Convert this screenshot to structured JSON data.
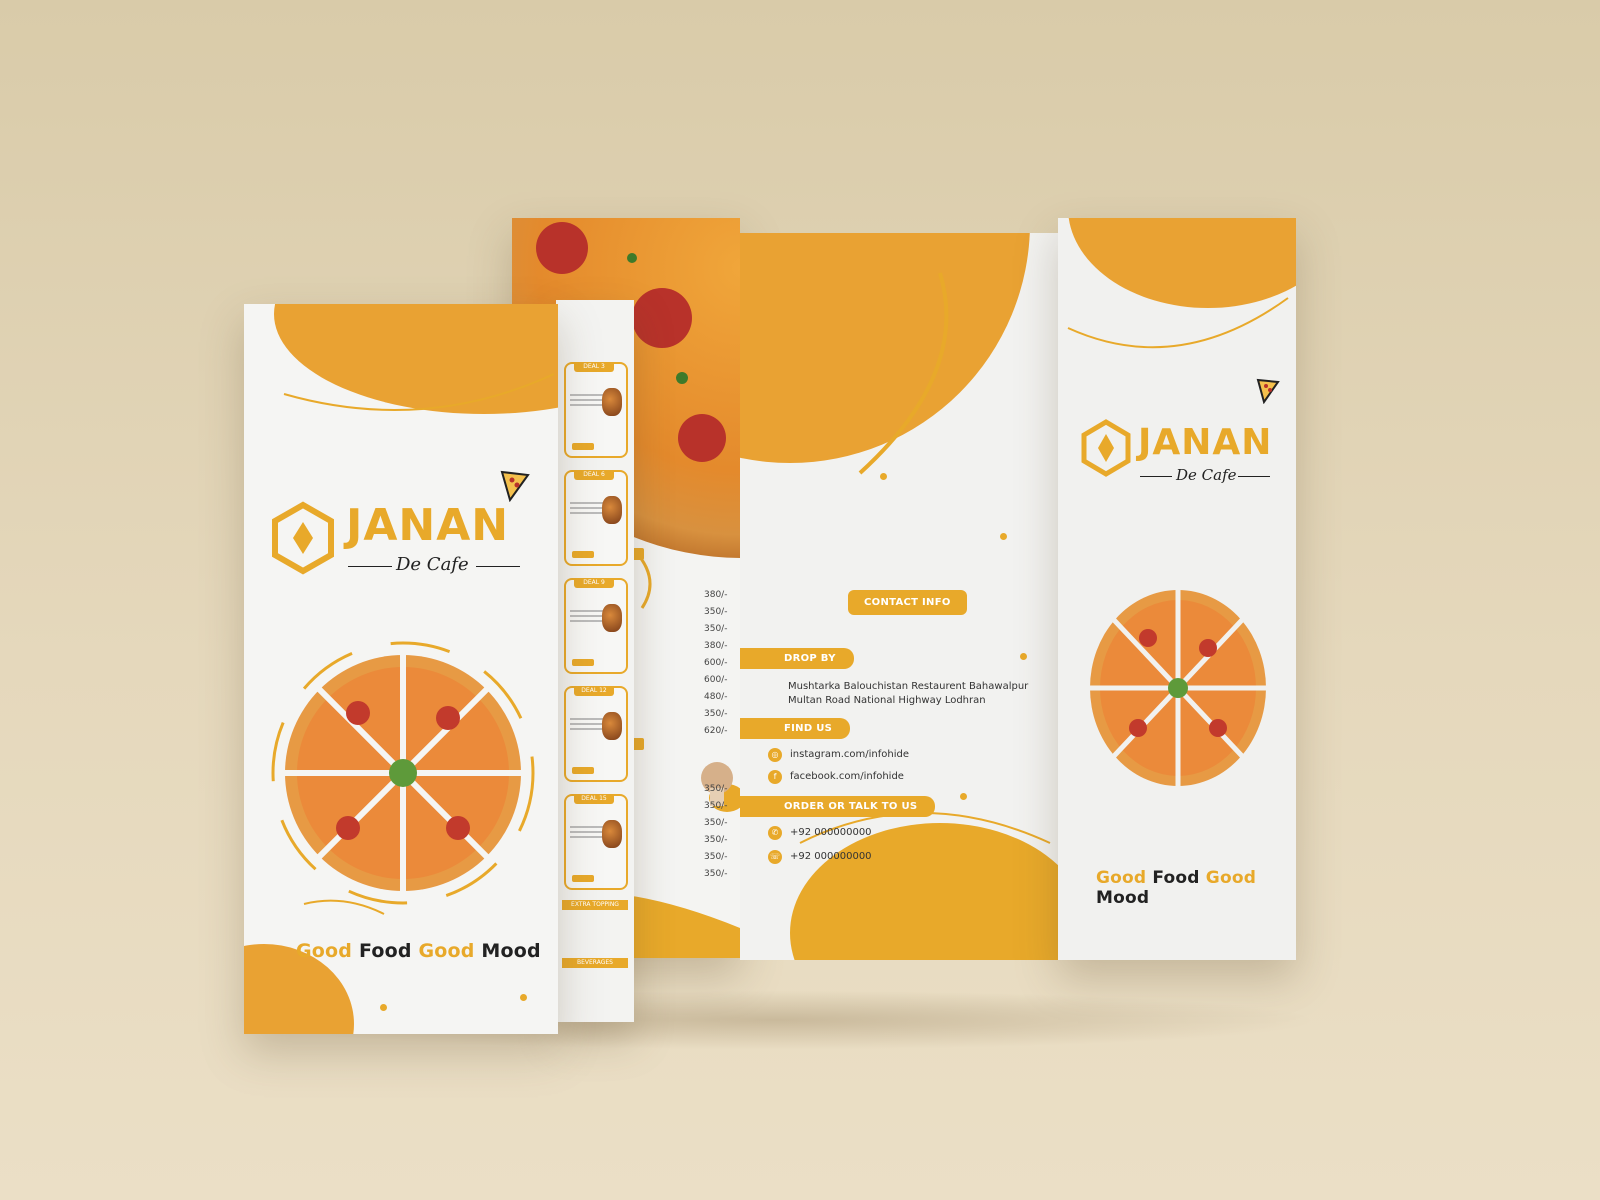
{
  "brand": {
    "name": "JANAN",
    "subtitle": "De Cafe",
    "slogan": [
      "Good",
      "Food",
      "Good",
      "Mood"
    ]
  },
  "colors": {
    "accent": "#e8a92a",
    "background": "#ddcfb1",
    "panel": "#f4f4f2",
    "text": "#222222"
  },
  "contact": {
    "title": "CONTACT INFO",
    "drop_by_label": "DROP BY",
    "address_line1": "Mushtarka Balouchistan Restaurent Bahawalpur",
    "address_line2": "Multan Road National Highway Lodhran",
    "find_us_label": "FIND US",
    "instagram": "instagram.com/infohide",
    "facebook": "facebook.com/infohide",
    "order_label": "ORDER OR TALK TO US",
    "phone1": "+92 000000000",
    "phone2": "+92 000000000",
    "icons": [
      "instagram-icon",
      "facebook-icon",
      "phone-icon",
      "whatsapp-icon"
    ]
  },
  "prices": {
    "group1": [
      "380/-",
      "350/-",
      "350/-",
      "380/-",
      "600/-",
      "600/-",
      "480/-",
      "350/-",
      "620/-"
    ],
    "group2": [
      "350/-",
      "350/-",
      "350/-",
      "350/-",
      "350/-",
      "350/-"
    ]
  },
  "deals": [
    "DEAL 3",
    "DEAL 6",
    "DEAL 9",
    "DEAL 12",
    "DEAL 15"
  ],
  "sections": [
    "EXTRA TOPPING",
    "BEVERAGES"
  ]
}
